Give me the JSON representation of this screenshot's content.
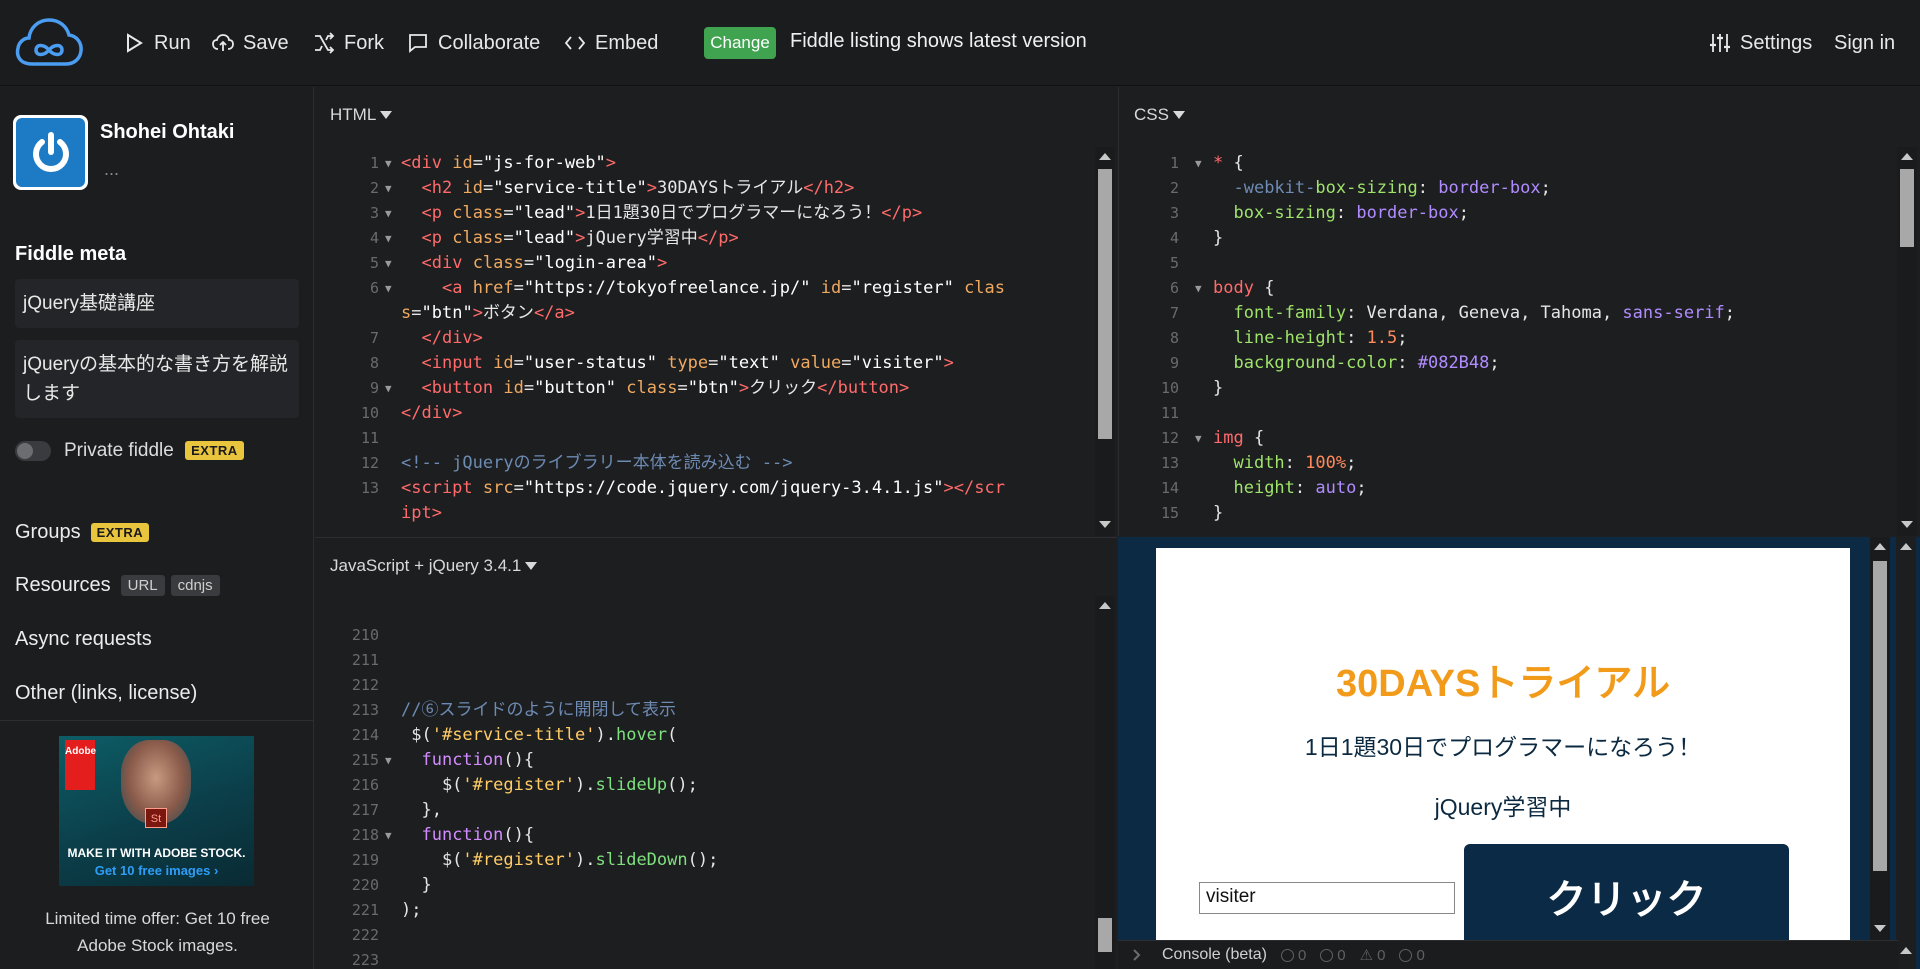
{
  "header": {
    "run": "Run",
    "save": "Save",
    "fork": "Fork",
    "collaborate": "Collaborate",
    "embed": "Embed",
    "change_badge": "Change",
    "listing_text": "Fiddle listing shows latest version",
    "settings": "Settings",
    "sign_in": "Sign in"
  },
  "sidebar": {
    "user_name": "Shohei Ohtaki",
    "user_more": "...",
    "fiddle_meta_title": "Fiddle meta",
    "meta_title_value": "jQuery基礎講座",
    "meta_desc_value": "jQueryの基本的な書き方を解説します",
    "private_label": "Private fiddle",
    "extra": "EXTRA",
    "groups": "Groups",
    "resources": "Resources",
    "resources_chip_url": "URL",
    "resources_chip_cdnjs": "cdnjs",
    "async_requests": "Async requests",
    "other": "Other (links, license)",
    "ad_logo": "Adobe",
    "ad_st": "St",
    "ad_line1": "MAKE IT WITH ADOBE STOCK.",
    "ad_line2": "Get 10 free images ›",
    "ad_text": "Limited time offer: Get 10 free Adobe Stock images."
  },
  "panels": {
    "html_title": "HTML",
    "css_title": "CSS",
    "js_title": "JavaScript + jQuery 3.4.1",
    "html_lines": [
      "1",
      "2",
      "3",
      "4",
      "5",
      "6",
      "",
      "7",
      "8",
      "9",
      "10",
      "11",
      "12",
      "13"
    ],
    "css_lines": [
      "1",
      "2",
      "3",
      "4",
      "5",
      "6",
      "7",
      "8",
      "9",
      "10",
      "11",
      "12",
      "13",
      "14",
      "15"
    ],
    "js_lines": [
      "210",
      "211",
      "212",
      "213",
      "214",
      "215",
      "216",
      "217",
      "218",
      "219",
      "220",
      "221",
      "222",
      "223"
    ]
  },
  "result": {
    "title": "30DAYSトライアル",
    "lead1": "1日1題30日でプログラマーになろう！",
    "lead2": "jQuery学習中",
    "input_value": "visiter",
    "button": "クリック"
  },
  "console": {
    "label": "Console (beta)",
    "count1": "0",
    "count2": "0",
    "count3": "0",
    "count4": "0"
  }
}
